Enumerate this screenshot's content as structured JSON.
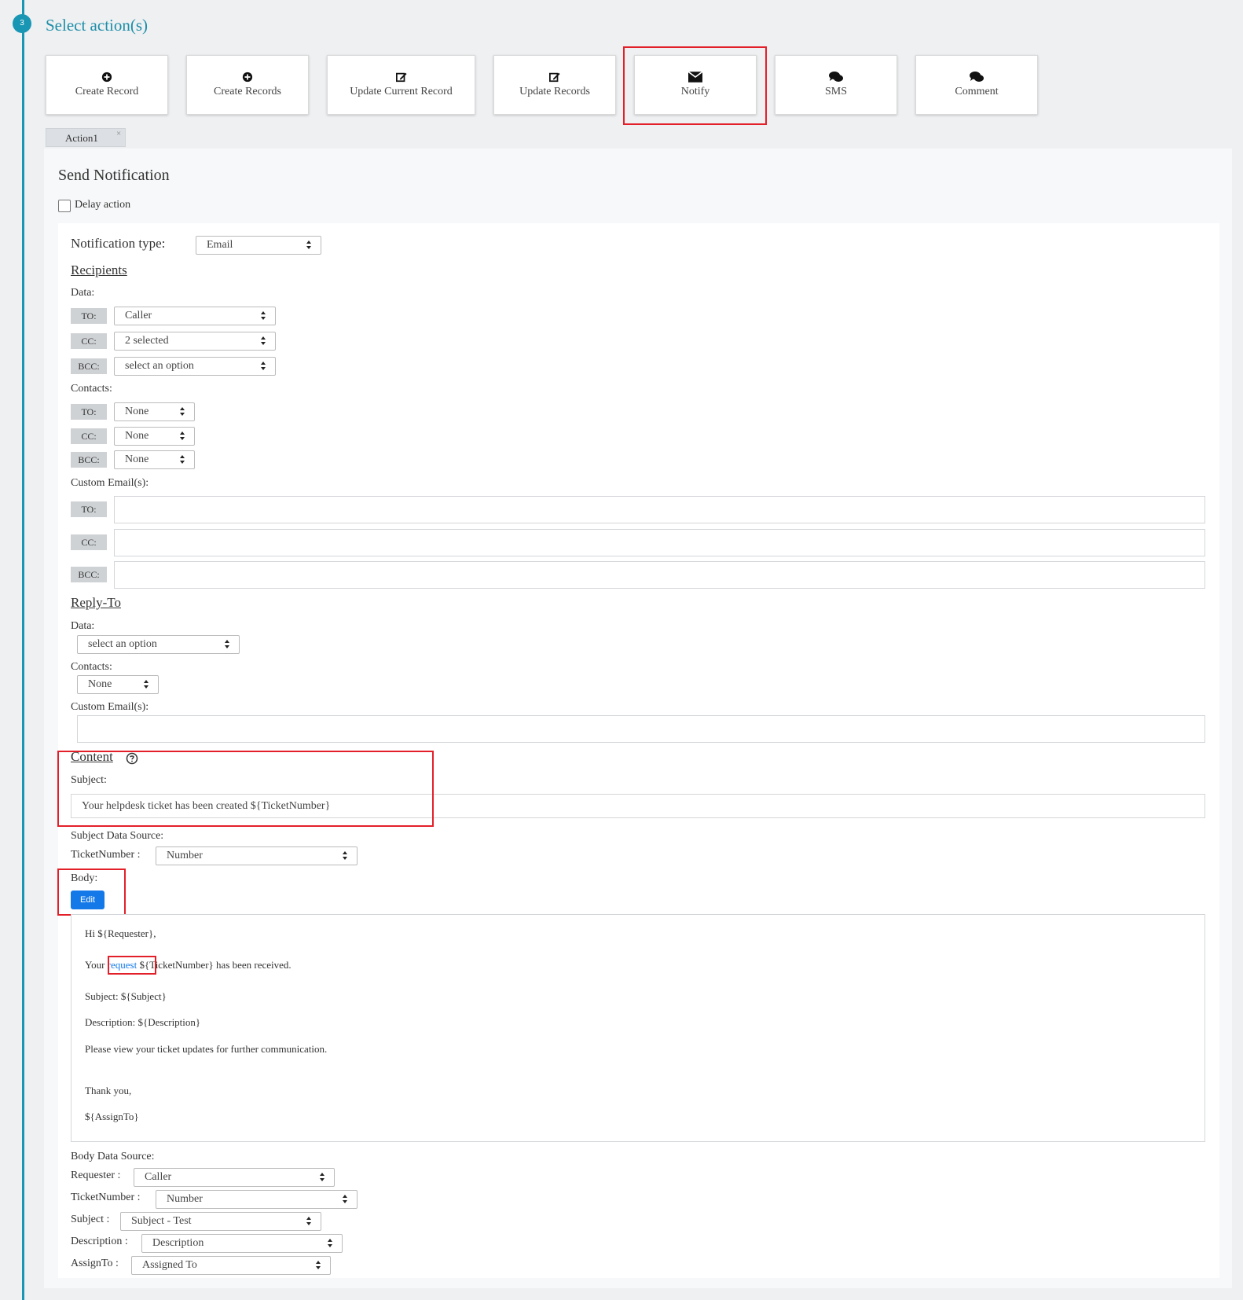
{
  "step": {
    "number": "3",
    "title": "Select action(s)"
  },
  "actions": [
    {
      "label": "Create Record",
      "icon": "plus-circle-icon"
    },
    {
      "label": "Create Records",
      "icon": "plus-circle-icon"
    },
    {
      "label": "Update Current Record",
      "icon": "edit-icon"
    },
    {
      "label": "Update Records",
      "icon": "edit-icon"
    },
    {
      "label": "Notify",
      "icon": "envelope-icon"
    },
    {
      "label": "SMS",
      "icon": "comments-icon"
    },
    {
      "label": "Comment",
      "icon": "comments-icon"
    }
  ],
  "tab": {
    "label": "Action1",
    "close": "×"
  },
  "panel": {
    "title": "Send Notification",
    "delay_label": "Delay action",
    "notification_type_label": "Notification type:",
    "notification_type_value": "Email",
    "recipients": {
      "heading": "Recipients",
      "data_label": "Data:",
      "data": {
        "to_tag": "TO:",
        "to_value": "Caller",
        "cc_tag": "CC:",
        "cc_value": "2 selected",
        "bcc_tag": "BCC:",
        "bcc_value": "select an option"
      },
      "contacts_label": "Contacts:",
      "contacts": {
        "to_tag": "TO:",
        "to_value": "None",
        "cc_tag": "CC:",
        "cc_value": "None",
        "bcc_tag": "BCC:",
        "bcc_value": "None"
      },
      "custom_label": "Custom Email(s):",
      "custom": {
        "to_tag": "TO:",
        "cc_tag": "CC:",
        "bcc_tag": "BCC:"
      }
    },
    "reply_to": {
      "heading": "Reply-To",
      "data_label": "Data:",
      "data_value": "select an option",
      "contacts_label": "Contacts:",
      "contacts_value": "None",
      "custom_label": "Custom Email(s):"
    },
    "content": {
      "heading": "Content",
      "help_icon": "question-circle-icon",
      "subject_label": "Subject:",
      "subject_value": "Your helpdesk ticket has been created ${TicketNumber}",
      "subject_source_label": "Subject Data Source:",
      "subject_source_field": "TicketNumber :",
      "subject_source_value": "Number",
      "body_label": "Body:",
      "edit_label": "Edit",
      "body": {
        "line1": "Hi ${Requester},",
        "line2_a": "Your",
        "line2_link": "request",
        "line2_b": "${TicketNumber} has been received.",
        "line3": "Subject: ${Subject}",
        "line4": "Description: ${Description}",
        "line5": "Please view your ticket updates for further communication.",
        "line6": "Thank you,",
        "line7": "${AssignTo}"
      },
      "body_source_label": "Body Data Source:",
      "body_sources": [
        {
          "field": "Requester :",
          "value": "Caller"
        },
        {
          "field": "TicketNumber :",
          "value": "Number"
        },
        {
          "field": "Subject :",
          "value": "Subject - Test"
        },
        {
          "field": "Description :",
          "value": "Description"
        },
        {
          "field": "AssignTo :",
          "value": "Assigned To"
        }
      ]
    }
  },
  "colors": {
    "accent": "#1996b3",
    "highlight": "#e3202a",
    "button": "#1479e8"
  }
}
